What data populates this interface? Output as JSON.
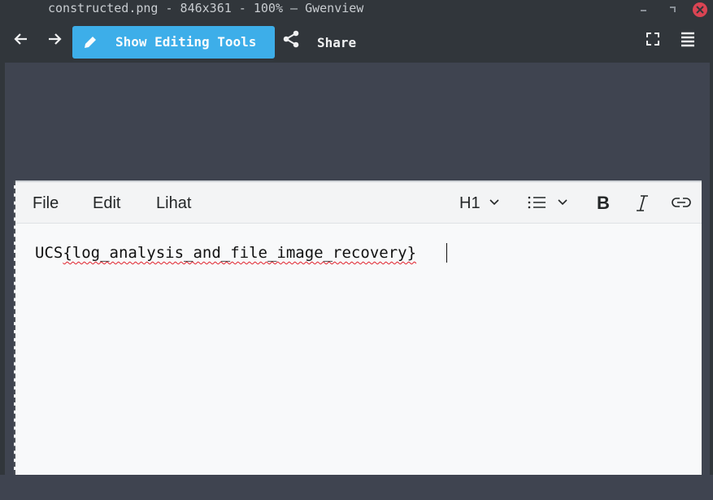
{
  "window": {
    "title": "constructed.png - 846x361 - 100% — Gwenview",
    "controls": [
      "minimize-button",
      "maximize-button",
      "close-button"
    ],
    "close_color": "#da4453"
  },
  "toolbar": {
    "back_icon": "arrow-left-icon",
    "forward_icon": "arrow-right-icon",
    "edit_button_label": "Show Editing Tools",
    "edit_icon": "pencil-icon",
    "share_label": "Share",
    "share_icon": "share-icon",
    "fullscreen_icon": "fullscreen-icon",
    "menu_icon": "hamburger-menu-icon",
    "accent": "#3daee9"
  },
  "image_content": {
    "menu": {
      "file": "File",
      "edit": "Edit",
      "view": "Lihat"
    },
    "format": {
      "heading": "H1",
      "list_icon": "bullet-list-icon",
      "bold": "B",
      "italic_icon": "italic-icon",
      "link_icon": "link-icon"
    },
    "text_prefix": "UCS",
    "text_body": "{log_analysis_and_file_image_recovery}"
  }
}
